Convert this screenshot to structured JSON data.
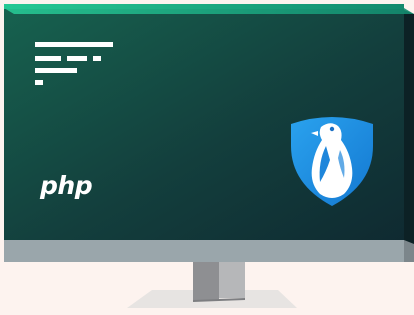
{
  "screen": {
    "logo_text": "php",
    "shield_icon": "penguin-shield-icon",
    "code_icon": "code-lines-icon"
  },
  "colors": {
    "background": "#fdf3ef",
    "screen_top": "#17624f",
    "screen_bottom": "#0f2f34",
    "bezel_top": "#20b88a",
    "chin": "#9aa6ab",
    "stand": "#a7a7a9",
    "shield": "#1e8de0"
  }
}
